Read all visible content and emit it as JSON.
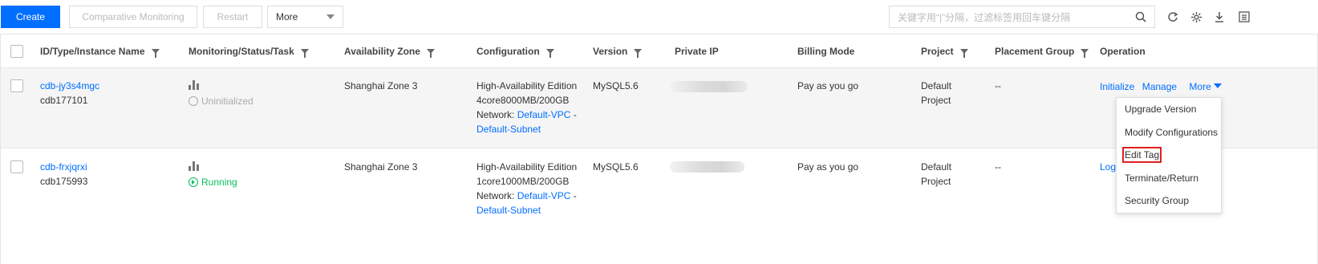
{
  "toolbar": {
    "create_label": "Create",
    "comparative_label": "Comparative Monitoring",
    "restart_label": "Restart",
    "more_label": "More",
    "search_placeholder": "关键字用“|”分隔，过滤标签用回车键分隔"
  },
  "table": {
    "headers": [
      "ID/Type/Instance Name",
      "Monitoring/Status/Task",
      "Availability Zone",
      "Configuration",
      "Version",
      "Private IP",
      "Billing Mode",
      "Project",
      "Placement Group",
      "Operation"
    ],
    "rows": [
      {
        "id": "cdb-jy3s4mgc",
        "name": "cdb177101",
        "status": "Uninitialized",
        "zone": "Shanghai Zone 3",
        "config_line1": "High-Availability Edition",
        "config_line2": "4core8000MB/200GB",
        "network_label": "Network:",
        "vpc": "Default-VPC",
        "separator": "-",
        "subnet": "Default-Subnet",
        "version": "MySQL5.6",
        "billing": "Pay as you go",
        "project_line1": "Default",
        "project_line2": "Project",
        "placement": "--",
        "op_initialize": "Initialize",
        "op_manage": "Manage",
        "op_more": "More"
      },
      {
        "id": "cdb-frxjqrxi",
        "name": "cdb175993",
        "status": "Running",
        "zone": "Shanghai Zone 3",
        "config_line1": "High-Availability Edition",
        "config_line2": "1core1000MB/200GB",
        "network_label": "Network:",
        "vpc": "Default-VPC",
        "separator": "-",
        "subnet": "Default-Subnet",
        "version": "MySQL5.6",
        "billing": "Pay as you go",
        "project_line1": "Default",
        "project_line2": "Project",
        "placement": "--",
        "op_login": "Logi"
      }
    ]
  },
  "more_menu": {
    "items": [
      "Upgrade Version",
      "Modify Configurations",
      "Edit Tag",
      "Terminate/Return",
      "Security Group"
    ],
    "highlighted": "Edit Tag"
  },
  "colors": {
    "primary": "#006eff",
    "running": "#0abf5b",
    "highlight_border": "#e02020"
  }
}
